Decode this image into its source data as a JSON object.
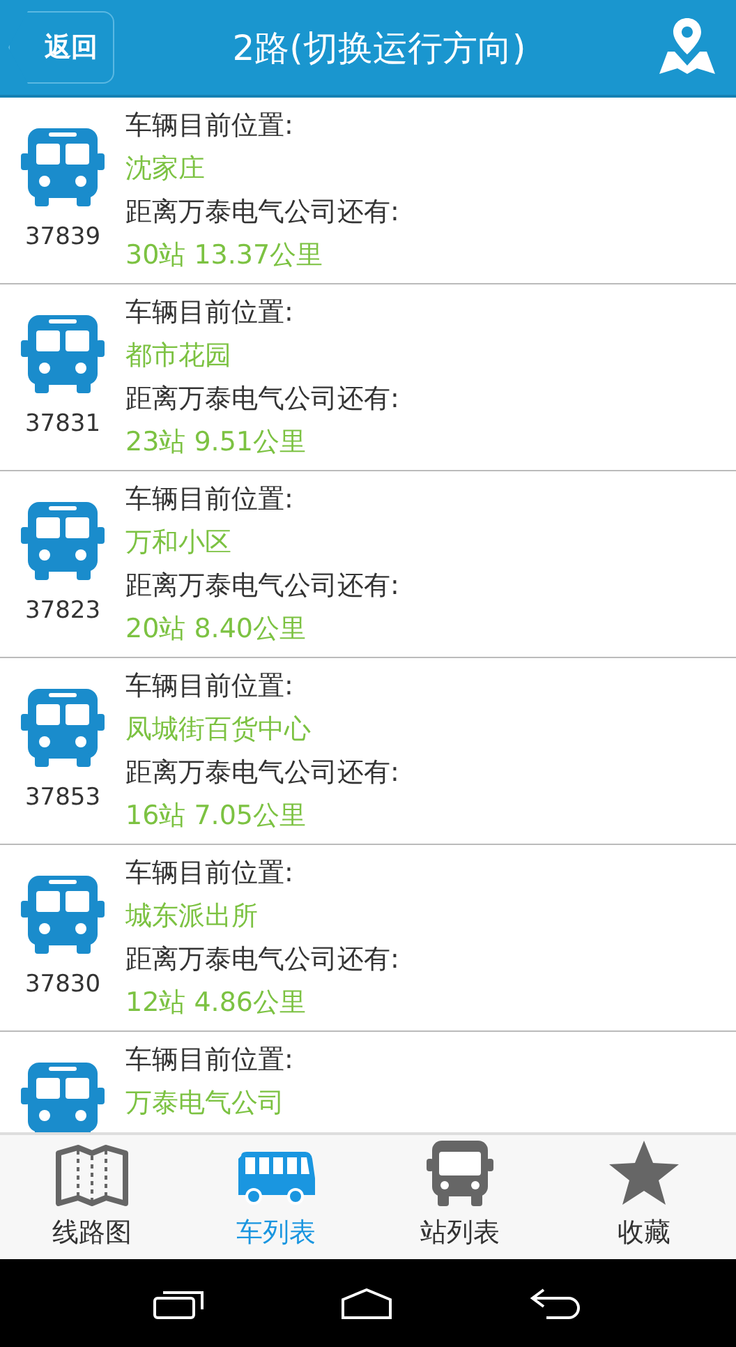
{
  "header": {
    "back": "返回",
    "title": "2路(切换运行方向)"
  },
  "buses": [
    {
      "number": "37839",
      "position_label": "车辆目前位置:",
      "position": "沈家庄",
      "distance_label": "距离万泰电气公司还有:",
      "distance": "30站  13.37公里"
    },
    {
      "number": "37831",
      "position_label": "车辆目前位置:",
      "position": "都市花园",
      "distance_label": "距离万泰电气公司还有:",
      "distance": "23站  9.51公里"
    },
    {
      "number": "37823",
      "position_label": "车辆目前位置:",
      "position": "万和小区",
      "distance_label": "距离万泰电气公司还有:",
      "distance": "20站  8.40公里"
    },
    {
      "number": "37853",
      "position_label": "车辆目前位置:",
      "position": "凤城街百货中心",
      "distance_label": "距离万泰电气公司还有:",
      "distance": "16站  7.05公里"
    },
    {
      "number": "37830",
      "position_label": "车辆目前位置:",
      "position": "城东派出所",
      "distance_label": "距离万泰电气公司还有:",
      "distance": "12站  4.86公里"
    },
    {
      "position_label": "车辆目前位置:",
      "position": "万泰电气公司"
    }
  ],
  "tabs": [
    {
      "kind": "map",
      "label": "线路图",
      "selected": false
    },
    {
      "kind": "bus",
      "label": "车列表",
      "selected": true
    },
    {
      "kind": "coach",
      "label": "站列表",
      "selected": false
    },
    {
      "kind": "star",
      "label": "收藏",
      "selected": false
    }
  ]
}
